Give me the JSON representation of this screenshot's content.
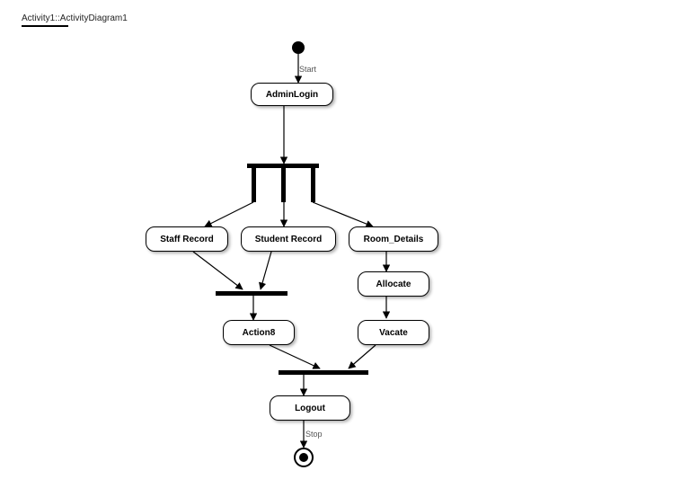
{
  "title": "Activity1::ActivityDiagram1",
  "labels": {
    "start": "Start",
    "stop": "Stop"
  },
  "nodes": {
    "adminLogin": "AdminLogin",
    "staffRecord": "Staff Record",
    "studentRecord": "Student Record",
    "roomDetails": "Room_Details",
    "allocate": "Allocate",
    "vacate": "Vacate",
    "action8": "Action8",
    "logout": "Logout"
  }
}
